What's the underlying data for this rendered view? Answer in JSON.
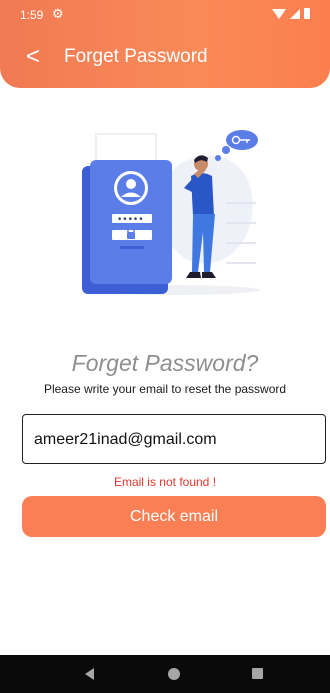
{
  "status_bar": {
    "time": "1:59",
    "settings_icon": "gear-icon",
    "icons": [
      "wifi-icon",
      "signal-icon",
      "battery-icon"
    ]
  },
  "header": {
    "back_icon": "chevron-left-icon",
    "back_glyph": "<",
    "title": "Forget Password",
    "color": "#fa8a57"
  },
  "illustration": {
    "icon": "login-illustration",
    "password_mask": "•••••"
  },
  "main": {
    "heading": "Forget Password?",
    "subheading": "Please write your email to reset the password",
    "email_value": "ameer21inad@gmail.com",
    "error_message": "Email is not found !",
    "error_color": "#e0372c",
    "submit_label": "Check email",
    "accent_color": "#fa7f54"
  },
  "nav_bar": {
    "back_icon": "nav-back-icon",
    "home_icon": "nav-home-icon",
    "recents_icon": "nav-recents-icon"
  }
}
